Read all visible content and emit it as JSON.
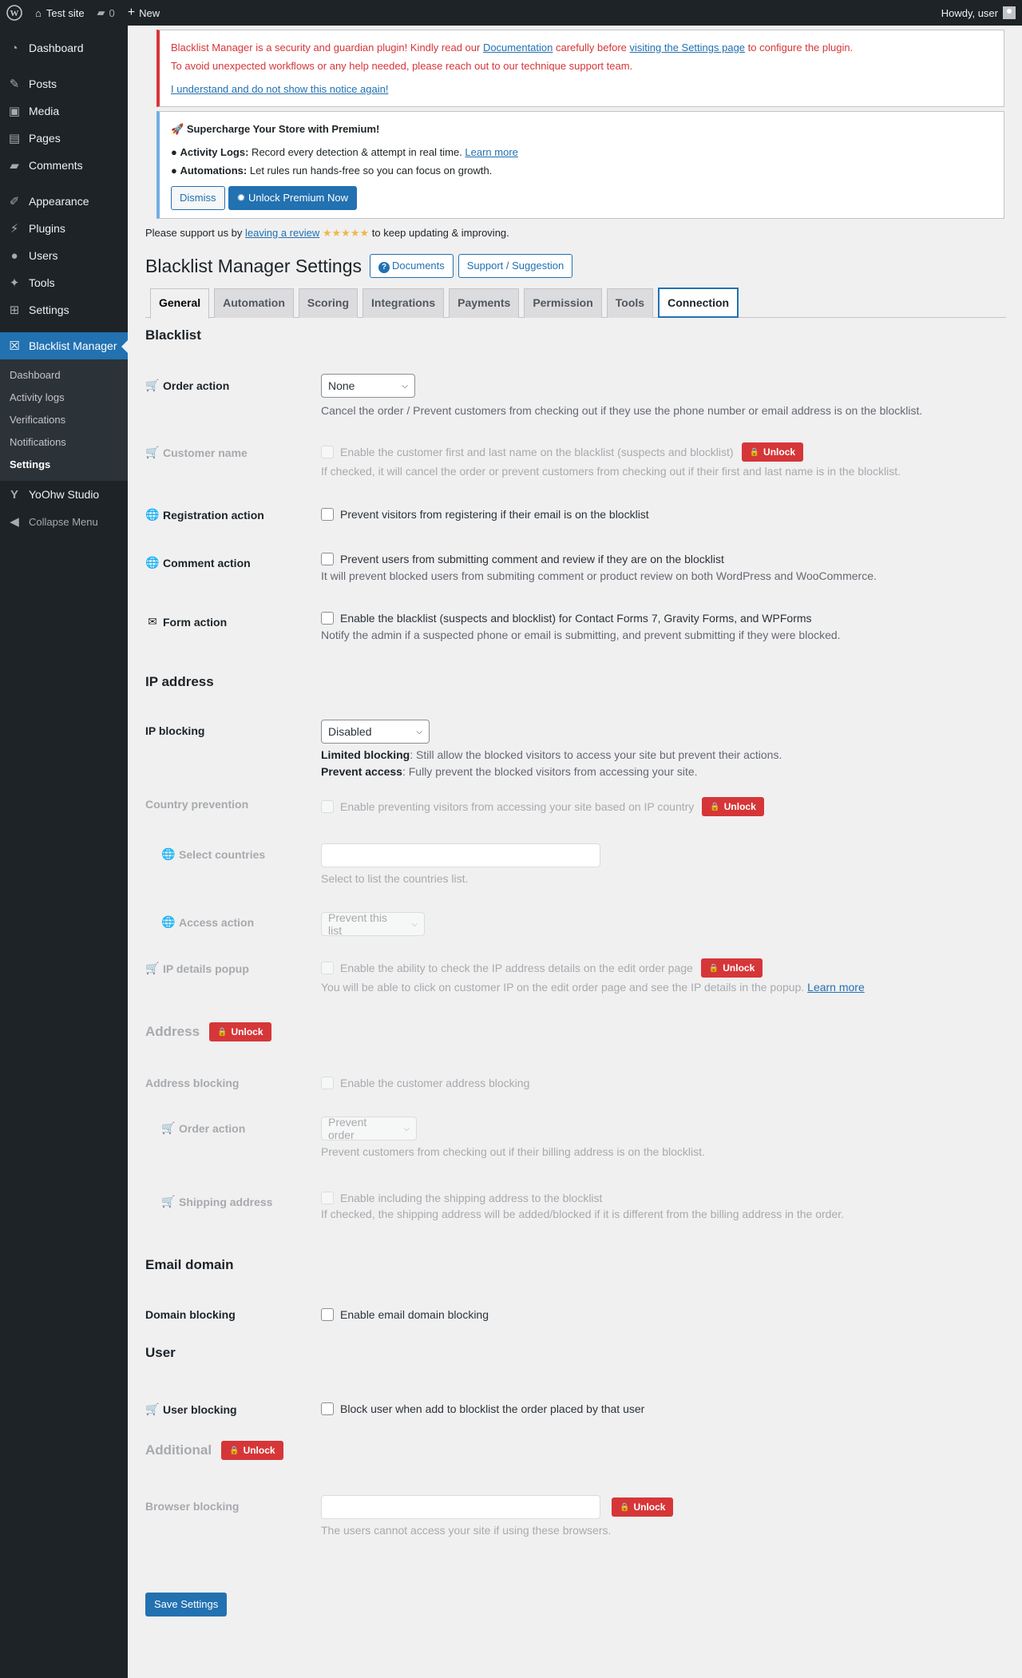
{
  "adminbar": {
    "site_name": "Test site",
    "comments_count": "0",
    "new_label": "New",
    "howdy": "Howdy, user"
  },
  "sidebar": {
    "items": [
      {
        "label": "Dashboard",
        "icon": "dashboard-icon"
      },
      {
        "label": "Posts",
        "icon": "pin-icon"
      },
      {
        "label": "Media",
        "icon": "media-icon"
      },
      {
        "label": "Pages",
        "icon": "pages-icon"
      },
      {
        "label": "Comments",
        "icon": "comment-icon"
      },
      {
        "label": "Appearance",
        "icon": "brush-icon"
      },
      {
        "label": "Plugins",
        "icon": "plug-icon"
      },
      {
        "label": "Users",
        "icon": "user-icon"
      },
      {
        "label": "Tools",
        "icon": "wrench-icon"
      },
      {
        "label": "Settings",
        "icon": "settings-icon"
      },
      {
        "label": "Blacklist Manager",
        "icon": "blacklist-icon"
      },
      {
        "label": "YoOhw Studio",
        "icon": "yoast-icon"
      },
      {
        "label": "Collapse Menu",
        "icon": "collapse-icon"
      }
    ],
    "submenu": [
      "Dashboard",
      "Activity logs",
      "Verifications",
      "Notifications",
      "Settings"
    ]
  },
  "notice": {
    "line1_a": "Blacklist Manager is a security and guardian plugin! Kindly read our ",
    "doc_link": "Documentation",
    "line1_b": " carefully before ",
    "settings_link": "visiting the Settings page",
    "line1_c": " to configure the plugin.",
    "line2": "To avoid unexpected workflows or any help needed, please reach out to our technique support team.",
    "dismiss_link": "I understand and do not show this notice again!"
  },
  "premium": {
    "title": "Supercharge Your Store with Premium!",
    "b1_label": "Activity Logs:",
    "b1_text": " Record every detection & attempt in real time. ",
    "b1_link": "Learn more",
    "b2_label": "Automations:",
    "b2_text": " Let rules run hands-free so you can focus on growth.",
    "dismiss": "Dismiss",
    "unlock": "Unlock Premium Now"
  },
  "support": {
    "a": "Please support us by ",
    "link": "leaving a review",
    "stars": "★★★★★",
    "b": " to keep updating & improving."
  },
  "header": {
    "title": "Blacklist Manager Settings",
    "documents": "Documents",
    "support": "Support / Suggestion"
  },
  "tabs": [
    "General",
    "Automation",
    "Scoring",
    "Integrations",
    "Payments",
    "Permission",
    "Tools",
    "Connection"
  ],
  "sections": {
    "blacklist": "Blacklist",
    "ip": "IP address",
    "address": "Address",
    "email": "Email domain",
    "user": "User",
    "additional": "Additional"
  },
  "unlock_label": "Unlock",
  "fields": {
    "order_action": {
      "label": "Order action",
      "value": "None",
      "desc": "Cancel the order / Prevent customers from checking out if they use the phone number or email address is on the blocklist."
    },
    "customer_name": {
      "label": "Customer name",
      "check": "Enable the customer first and last name on the blacklist (suspects and blocklist)",
      "desc": "If checked, it will cancel the order or prevent customers from checking out if their first and last name is in the blocklist."
    },
    "registration": {
      "label": "Registration action",
      "check": "Prevent visitors from registering if their email is on the blocklist"
    },
    "comment": {
      "label": "Comment action",
      "check": "Prevent users from submitting comment and review if they are on the blocklist",
      "desc": "It will prevent blocked users from submiting comment or product review on both WordPress and WooCommerce."
    },
    "form": {
      "label": "Form action",
      "check": "Enable the blacklist (suspects and blocklist) for Contact Forms 7, Gravity Forms, and WPForms",
      "desc": "Notify the admin if a suspected phone or email is submitting, and prevent submitting if they were blocked."
    },
    "ip_blocking": {
      "label": "IP blocking",
      "value": "Disabled",
      "d1_b": "Limited blocking",
      "d1": ": Still allow the blocked visitors to access your site but prevent their actions.",
      "d2_b": "Prevent access",
      "d2": ": Fully prevent the blocked visitors from accessing your site."
    },
    "country": {
      "label": "Country prevention",
      "check": "Enable preventing visitors from accessing your site based on IP country"
    },
    "select_countries": {
      "label": "Select countries",
      "desc": "Select to list the countries list."
    },
    "access_action": {
      "label": "Access action",
      "value": "Prevent this list"
    },
    "ip_popup": {
      "label": "IP details popup",
      "check": "Enable the ability to check the IP address details on the edit order page",
      "desc": "You will be able to click on customer IP on the edit order page and see the IP details in the popup. ",
      "link": "Learn more"
    },
    "address_blocking": {
      "label": "Address blocking",
      "check": "Enable the customer address blocking"
    },
    "addr_order_action": {
      "label": "Order action",
      "value": "Prevent order",
      "desc": "Prevent customers from checking out if their billing address is on the blocklist."
    },
    "shipping": {
      "label": "Shipping address",
      "check": "Enable including the shipping address to the blocklist",
      "desc": "If checked, the shipping address will be added/blocked if it is different from the billing address in the order."
    },
    "domain": {
      "label": "Domain blocking",
      "check": "Enable email domain blocking"
    },
    "user_blocking": {
      "label": "User blocking",
      "check": "Block user when add to blocklist the order placed by that user"
    },
    "browser": {
      "label": "Browser blocking",
      "desc": "The users cannot access your site if using these browsers."
    }
  },
  "save_label": "Save Settings",
  "colors": {
    "accent": "#2271b1",
    "danger": "#d63638",
    "admin_bg": "#1d2327"
  }
}
